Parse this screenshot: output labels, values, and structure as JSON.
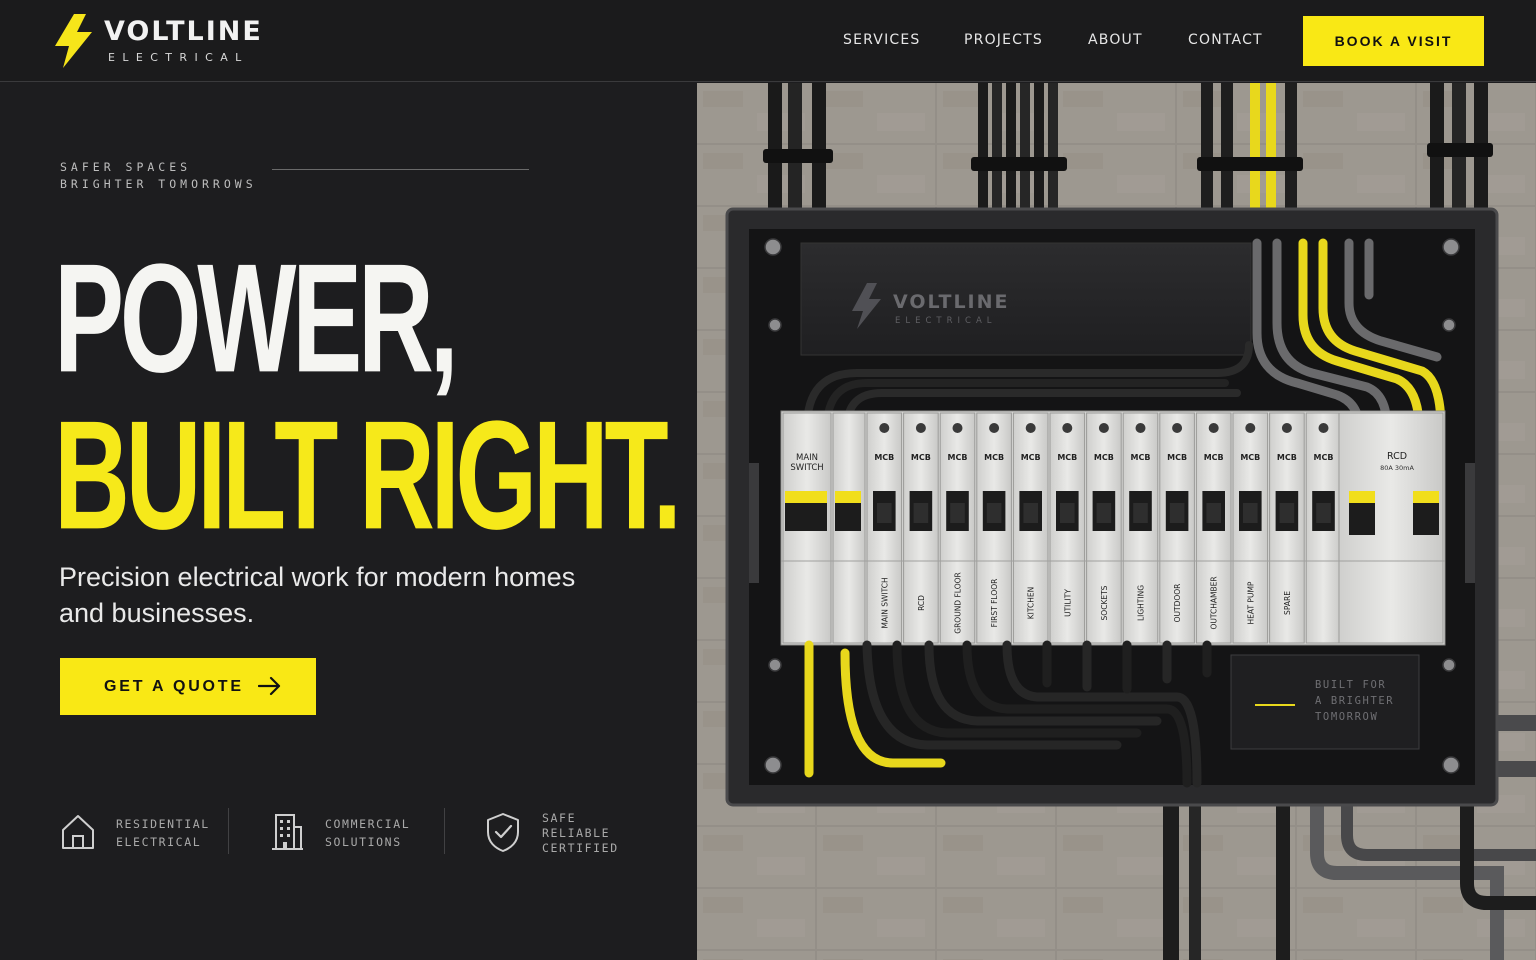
{
  "brand": {
    "name": "VOLTLINE",
    "tagline": "ELECTRICAL"
  },
  "nav": {
    "items": [
      "SERVICES",
      "PROJECTS",
      "ABOUT",
      "CONTACT"
    ],
    "cta_label": "BOOK A VISIT"
  },
  "hero": {
    "tag_lines": [
      "SAFER SPACES",
      "BRIGHTER TOMORROWS"
    ],
    "headline_line1": "POWER,",
    "headline_line2": "BUILT RIGHT.",
    "lead": "Precision electrical work for modern homes and businesses.",
    "cta_label": "GET A QUOTE"
  },
  "features": [
    {
      "icon": "house-icon",
      "lines": [
        "RESIDENTIAL",
        "ELECTRICAL"
      ]
    },
    {
      "icon": "building-icon",
      "lines": [
        "COMMERCIAL",
        "SOLUTIONS"
      ]
    },
    {
      "icon": "shield-check-icon",
      "lines": [
        "SAFE",
        "RELIABLE",
        "CERTIFIED"
      ]
    }
  ],
  "panel": {
    "brand_name": "VOLTLINE",
    "brand_sub": "ELECTRICAL",
    "main_switch": [
      "MAIN",
      "SWITCH"
    ],
    "breaker_label": "MCB",
    "rcd_label": "RCD",
    "rcd_rating": "80A 30mA",
    "circuits": [
      "MAIN SWITCH",
      "RCD",
      "GROUND FLOOR",
      "FIRST FLOOR",
      "KITCHEN",
      "UTILITY",
      "SOCKETS",
      "LIGHTING",
      "OUTDOOR",
      "OUTCHAMBER",
      "HEAT PUMP",
      "SPARE"
    ],
    "plate_lines": [
      "BUILT FOR",
      "A BRIGHTER",
      "TOMORROW"
    ]
  },
  "colors": {
    "accent": "#f9e815",
    "background": "#1d1d1f",
    "text": "#f5f5f2"
  }
}
